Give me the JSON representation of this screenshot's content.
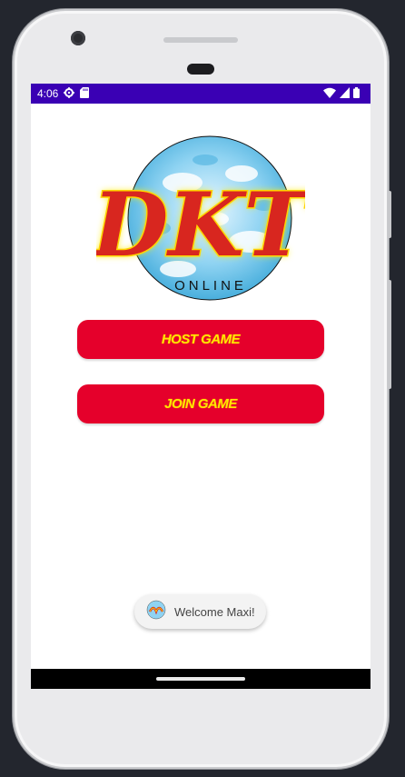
{
  "status_bar": {
    "time": "4:06",
    "left_icons": [
      "settings-icon",
      "sd-card-icon"
    ],
    "right_icons": [
      "wifi-icon",
      "cell-signal-icon",
      "battery-icon"
    ],
    "color": "#3a00b4"
  },
  "logo": {
    "main_text": "DKT",
    "sub_text": "ONLINE"
  },
  "buttons": {
    "host_label": "HOST GAME",
    "join_label": "JOIN GAME",
    "bg_color": "#e5002b",
    "text_color": "#ffe600"
  },
  "toast": {
    "message": "Welcome Maxi!"
  }
}
